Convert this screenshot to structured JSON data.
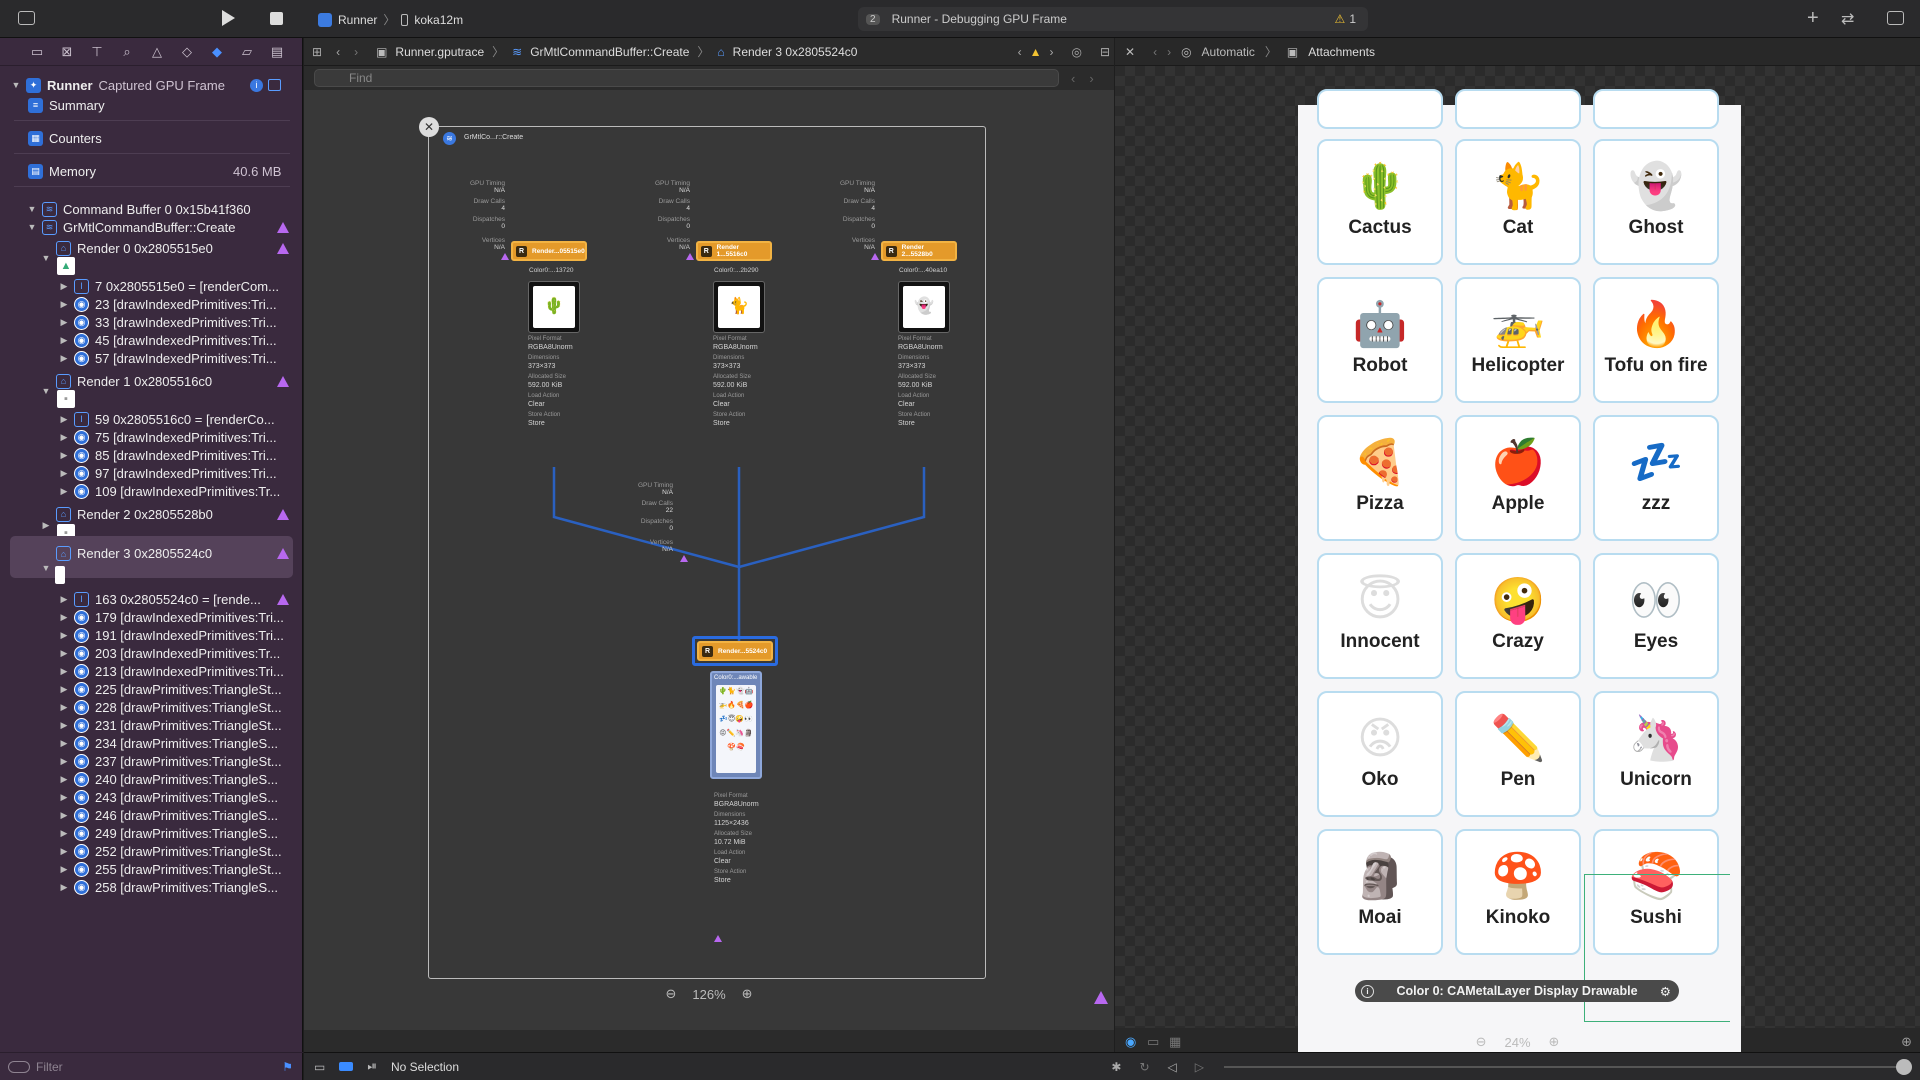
{
  "toolbar": {
    "scheme": "Runner",
    "device": "koka12m",
    "activity": "Runner - Debugging GPU Frame",
    "activity_badge": "2",
    "warning_count": "1"
  },
  "navigator": {
    "root": "Runner",
    "root_sub": "Captured GPU Frame",
    "summary": "Summary",
    "counters": "Counters",
    "memory": "Memory",
    "memory_size": "40.6 MB",
    "command_buffer": "Command Buffer 0 0x15b41f360",
    "create": "GrMtlCommandBuffer::Create",
    "render0": "Render 0 0x2805515e0",
    "r0_items": [
      "7 0x2805515e0 = [renderCom...",
      "23 [drawIndexedPrimitives:Tri...",
      "33 [drawIndexedPrimitives:Tri...",
      "45 [drawIndexedPrimitives:Tri...",
      "57 [drawIndexedPrimitives:Tri..."
    ],
    "render1": "Render 1 0x2805516c0",
    "r1_items": [
      "59 0x2805516c0 = [renderCo...",
      "75 [drawIndexedPrimitives:Tri...",
      "85 [drawIndexedPrimitives:Tri...",
      "97 [drawIndexedPrimitives:Tri...",
      "109 [drawIndexedPrimitives:Tr..."
    ],
    "render2": "Render 2 0x2805528b0",
    "render3": "Render 3 0x2805524c0",
    "r3_items": [
      "163 0x2805524c0 = [rende...",
      "179 [drawIndexedPrimitives:Tri...",
      "191 [drawIndexedPrimitives:Tri...",
      "203 [drawIndexedPrimitives:Tr...",
      "213 [drawIndexedPrimitives:Tri...",
      "225 [drawPrimitives:TriangleSt...",
      "228 [drawPrimitives:TriangleSt...",
      "231 [drawPrimitives:TriangleSt...",
      "234 [drawPrimitives:TriangleS...",
      "237 [drawPrimitives:TriangleSt...",
      "240 [drawPrimitives:TriangleS...",
      "243 [drawPrimitives:TriangleS...",
      "246 [drawPrimitives:TriangleS...",
      "249 [drawPrimitives:TriangleS...",
      "252 [drawPrimitives:TriangleSt...",
      "255 [drawPrimitives:TriangleSt...",
      "258 [drawPrimitives:TriangleS..."
    ],
    "filter_placeholder": "Filter"
  },
  "editor": {
    "crumbs": [
      "Runner.gputrace",
      "GrMtlCommandBuffer::Create",
      "Render 3 0x2805524c0"
    ],
    "find_placeholder": "Find",
    "frame_title": "GrMtlCo...r::Create",
    "zoom": "126%",
    "graph": {
      "gpu_timing": "GPU Timing",
      "na": "N/A",
      "draw_calls": "Draw Calls",
      "dispatches": "Dispatches",
      "vertices": "Vertices",
      "dc4": "4",
      "d0": "0",
      "dc22": "22",
      "r0": "Render...05515e0",
      "r1": "Render 1...5516c0",
      "r2": "Render 2...5528b0",
      "r3": "Render...5524c0",
      "c0": "Color0:...13720",
      "c1": "Color0:...2b290",
      "c2": "Color0:...40ea10",
      "c3": "Color0:...awable",
      "pf": "Pixel Format",
      "rgba": "RGBA8Unorm",
      "bgra": "BGRA8Unorm",
      "dim": "Dimensions",
      "d373": "373×373",
      "d1125": "1125×2436",
      "alloc": "Allocated Size",
      "a592": "592.00 KiB",
      "a1072": "10.72 MiB",
      "load": "Load Action",
      "clear": "Clear",
      "store": "Store Action",
      "storev": "Store"
    }
  },
  "assistant": {
    "crumb_auto": "Automatic",
    "crumb_att": "Attachments",
    "zoom": "24%",
    "caption": "Color 0: CAMetalLayer Display Drawable",
    "cards": [
      {
        "emoji": "🌵",
        "label": "Cactus"
      },
      {
        "emoji": "🐈",
        "label": "Cat"
      },
      {
        "emoji": "👻",
        "label": "Ghost"
      },
      {
        "emoji": "🤖",
        "label": "Robot"
      },
      {
        "emoji": "🚁",
        "label": "Helicopter"
      },
      {
        "emoji": "🔥",
        "label": "Tofu on fire"
      },
      {
        "emoji": "🍕",
        "label": "Pizza"
      },
      {
        "emoji": "🍎",
        "label": "Apple"
      },
      {
        "emoji": "💤",
        "label": "zzz"
      },
      {
        "emoji": "😇",
        "label": "Innocent"
      },
      {
        "emoji": "🤪",
        "label": "Crazy"
      },
      {
        "emoji": "👀",
        "label": "Eyes"
      },
      {
        "emoji": "😡",
        "label": "Oko"
      },
      {
        "emoji": "✏️",
        "label": "Pen"
      },
      {
        "emoji": "🦄",
        "label": "Unicorn"
      },
      {
        "emoji": "🗿",
        "label": "Moai"
      },
      {
        "emoji": "🍄",
        "label": "Kinoko"
      },
      {
        "emoji": "🍣",
        "label": "Sushi"
      }
    ]
  },
  "debugbar": {
    "selection": "No Selection"
  }
}
